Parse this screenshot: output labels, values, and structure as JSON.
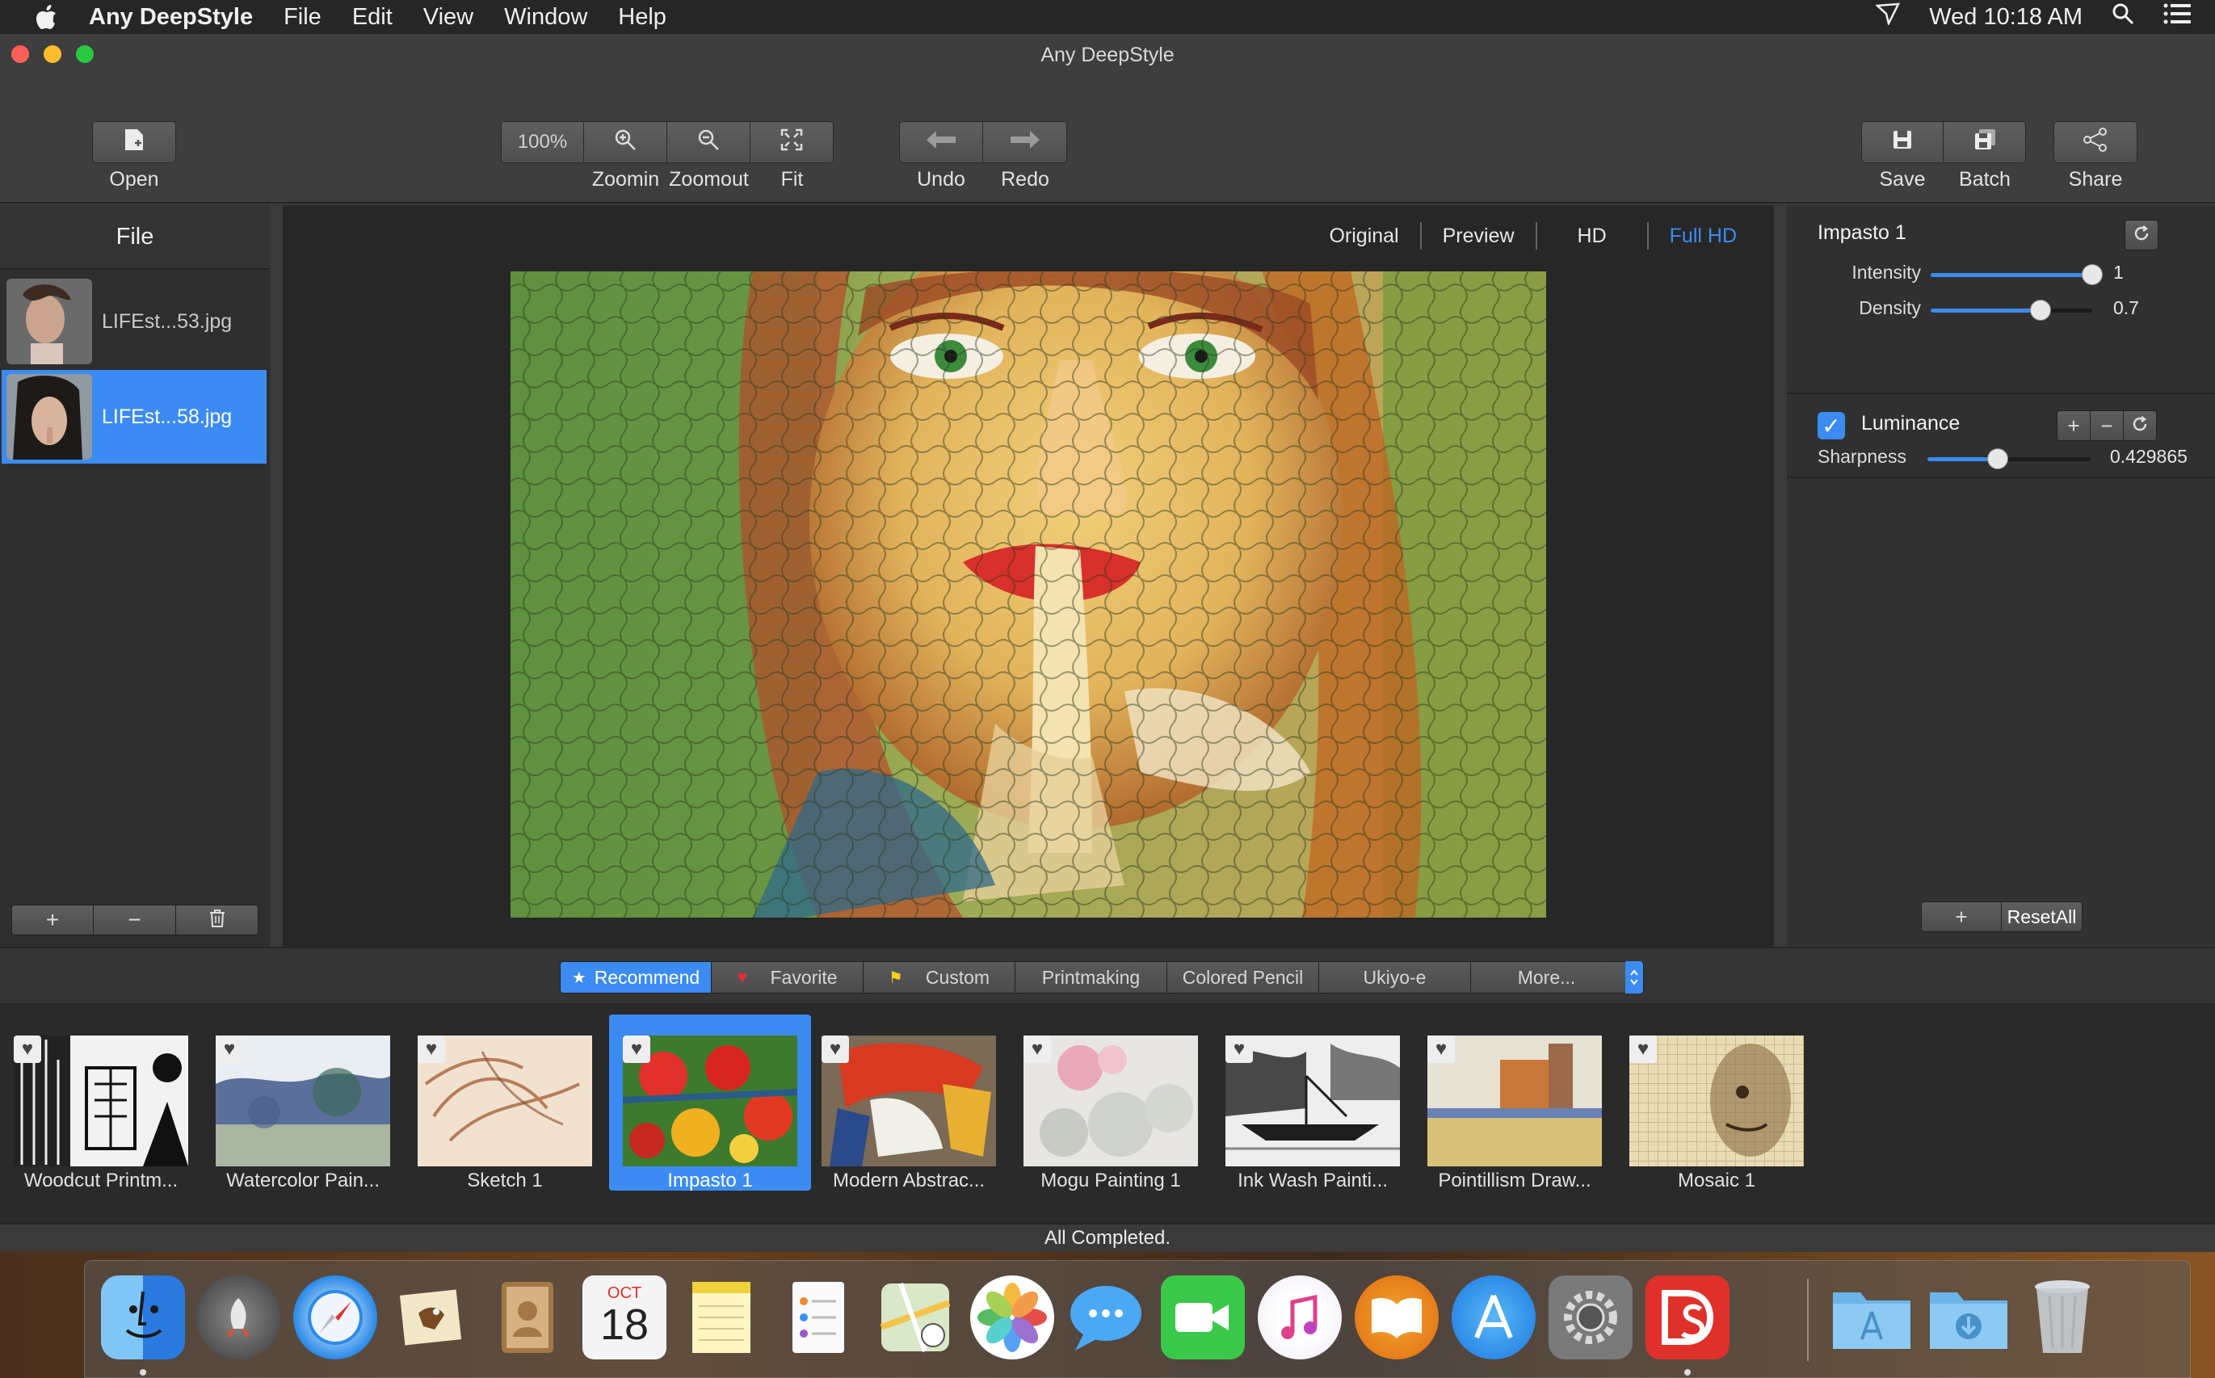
{
  "menubar": {
    "app_name": "Any DeepStyle",
    "items": [
      "File",
      "Edit",
      "View",
      "Window",
      "Help"
    ],
    "clock": "Wed 10:18 AM"
  },
  "window": {
    "title": "Any DeepStyle"
  },
  "toolbar": {
    "open": "Open",
    "zoom_level": "100%",
    "zoomin": "Zoomin",
    "zoomout": "Zoomout",
    "fit": "Fit",
    "undo": "Undo",
    "redo": "Redo",
    "save": "Save",
    "batch": "Batch",
    "share": "Share"
  },
  "files": {
    "header": "File",
    "items": [
      {
        "name": "LIFEst...53.jpg",
        "selected": false
      },
      {
        "name": "LIFEst...58.jpg",
        "selected": true
      }
    ]
  },
  "view_tabs": {
    "items": [
      "Original",
      "Preview",
      "HD",
      "Full HD"
    ],
    "active": "Full HD"
  },
  "adjust": {
    "style_name": "Impasto 1",
    "intensity_label": "Intensity",
    "intensity_value": "1",
    "intensity_level": 1.0,
    "density_label": "Density",
    "density_value": "0.7",
    "density_level": 0.68,
    "luminance_label": "Luminance",
    "luminance_checked": true,
    "sharpness_label": "Sharpness",
    "sharpness_value": "0.429865",
    "sharpness_level": 0.43,
    "reset_all": "ResetAll"
  },
  "categories": {
    "items": [
      "Recommend",
      "Favorite",
      "Custom",
      "Printmaking",
      "Colored Pencil",
      "Ukiyo-e",
      "More..."
    ],
    "active": "Recommend"
  },
  "styles": [
    {
      "name": "Woodcut Printm..."
    },
    {
      "name": "Watercolor Pain..."
    },
    {
      "name": "Sketch 1"
    },
    {
      "name": "Impasto 1",
      "selected": true
    },
    {
      "name": "Modern Abstrac..."
    },
    {
      "name": "Mogu Painting 1"
    },
    {
      "name": "Ink Wash Painti..."
    },
    {
      "name": "Pointillism Draw..."
    },
    {
      "name": "Mosaic 1"
    }
  ],
  "status": "All Completed.",
  "dock": {
    "calendar_month": "OCT",
    "calendar_day": "18",
    "icons": [
      "finder-icon",
      "launchpad-icon",
      "safari-icon",
      "mail-icon",
      "contacts-icon",
      "calendar-icon",
      "notes-icon",
      "reminders-icon",
      "maps-icon",
      "photos-icon",
      "messages-icon",
      "facetime-icon",
      "itunes-icon",
      "ibooks-icon",
      "app-store-icon",
      "system-preferences-icon",
      "any-deepstyle-icon",
      "applications-folder-icon",
      "downloads-folder-icon",
      "trash-icon"
    ]
  },
  "colors": {
    "accent": "#3b8bf2",
    "window_bg": "#3a3a3a",
    "panel_bg": "#2e2e2e"
  }
}
